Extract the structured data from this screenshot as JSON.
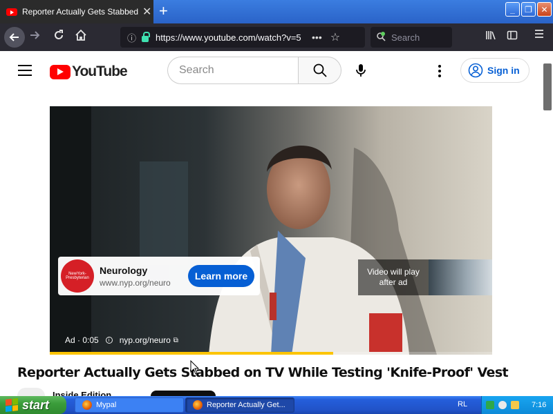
{
  "browser": {
    "tab_title": "Reporter Actually Gets Stabbed on TV While Testing 'Knife-Proof' Vest",
    "new_tab_icon": "plus-icon",
    "url_prefix": "https://www.",
    "url_domain": "youtube.com",
    "url_path": "/watch?v=5",
    "search_placeholder": "Search"
  },
  "youtube": {
    "logo_text": "YouTube",
    "search_placeholder": "Search",
    "sign_in_label": "Sign in",
    "accent": "#065fd4",
    "brand_red": "#ff0000"
  },
  "player": {
    "ad": {
      "advertiser_logo": "NewYork-Presbyterian",
      "title": "Neurology",
      "url": "www.nyp.org/neuro",
      "cta": "Learn more",
      "badge_label": "Ad · 0:05",
      "badge_url": "nyp.org/neuro",
      "preview_text": "Video will play after ad"
    },
    "progress_fraction": 0.64,
    "progress_color": "#fcc400"
  },
  "video": {
    "title": "Reporter Actually Gets Stabbed on TV While Testing 'Knife-Proof' Vest",
    "channel_partial": "Inside Edition"
  },
  "taskbar": {
    "start_label": "start",
    "items": [
      {
        "label": "Mypal"
      },
      {
        "label": "Reporter Actually Get..."
      }
    ],
    "lang": "RL",
    "clock": "7:16"
  }
}
